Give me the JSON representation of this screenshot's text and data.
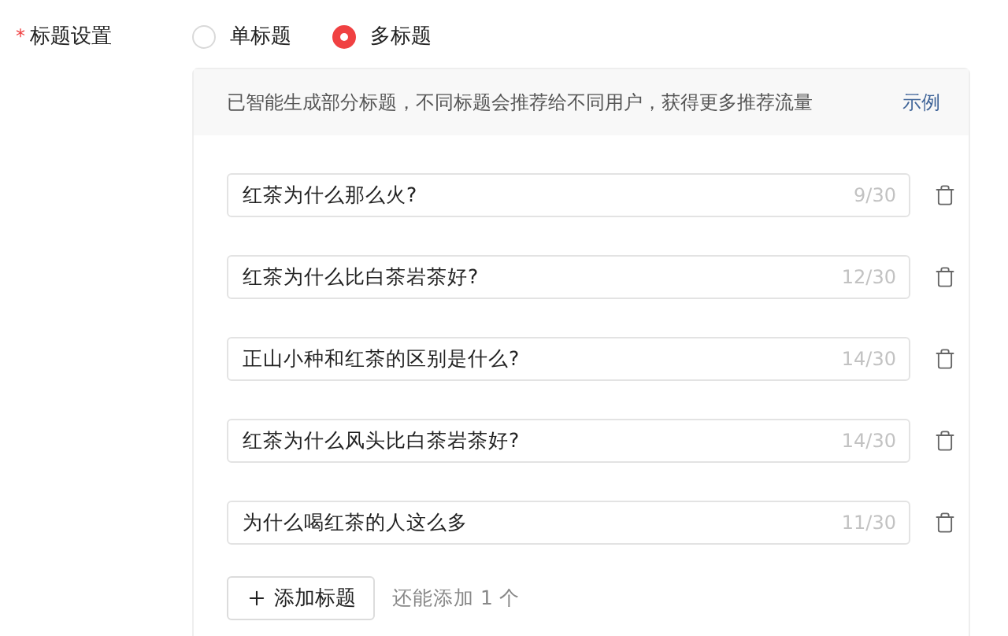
{
  "field": {
    "label": "标题设置",
    "required_mark": "*"
  },
  "title_modes": [
    {
      "label": "单标题",
      "selected": false
    },
    {
      "label": "多标题",
      "selected": true
    }
  ],
  "notice": {
    "text": "已智能生成部分标题，不同标题会推荐给不同用户，获得更多推荐流量",
    "link": "示例"
  },
  "titles": [
    {
      "value": "红茶为什么那么火?",
      "count": "9/30"
    },
    {
      "value": "红茶为什么比白茶岩茶好?",
      "count": "12/30"
    },
    {
      "value": "正山小种和红茶的区别是什么?",
      "count": "14/30"
    },
    {
      "value": "红茶为什么风头比白茶岩茶好?",
      "count": "14/30"
    },
    {
      "value": "为什么喝红茶的人这么多",
      "count": "11/30"
    }
  ],
  "add_button": {
    "label": "添加标题"
  },
  "remaining": "还能添加 1 个"
}
